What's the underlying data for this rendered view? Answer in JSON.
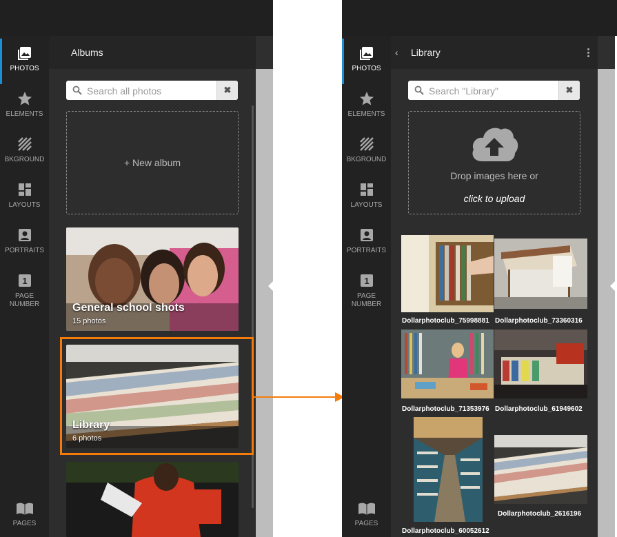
{
  "rail": {
    "items": [
      {
        "label": "PHOTOS",
        "icon": "photo-icon"
      },
      {
        "label": "ELEMENTS",
        "icon": "star-icon"
      },
      {
        "label": "BKGROUND",
        "icon": "stripes-icon"
      },
      {
        "label": "LAYOUTS",
        "icon": "layout-grid-icon"
      },
      {
        "label": "PORTRAITS",
        "icon": "portrait-icon"
      },
      {
        "label_line1": "PAGE",
        "label_line2": "NUMBER",
        "icon": "page-number-icon",
        "icon_text": "1"
      }
    ],
    "pages_label": "PAGES"
  },
  "albums_panel": {
    "title": "Albums",
    "search_placeholder": "Search all photos",
    "clear_glyph": "✖",
    "new_album_label": "+ New album",
    "albums": [
      {
        "name": "General school shots",
        "count": "15 photos"
      },
      {
        "name": "Library",
        "count": "6 photos"
      }
    ]
  },
  "library_panel": {
    "back_glyph": "‹",
    "title": "Library",
    "search_placeholder": "Search \"Library\"",
    "clear_glyph": "✖",
    "drop_text": "Drop images here or",
    "click_text": "click to upload",
    "photos": [
      {
        "label": "Dollarphotoclub_75998881"
      },
      {
        "label": "Dollarphotoclub_73360316"
      },
      {
        "label": "Dollarphotoclub_71353976"
      },
      {
        "label": "Dollarphotoclub_61949602"
      },
      {
        "label": "Dollarphotoclub_60052612"
      },
      {
        "label": "Dollarphotoclub_2616196"
      }
    ]
  },
  "colors": {
    "accent": "#1a8fd6",
    "highlight": "#f47c0b",
    "panel_bg": "#2d2d2d",
    "rail_bg": "#222222"
  }
}
